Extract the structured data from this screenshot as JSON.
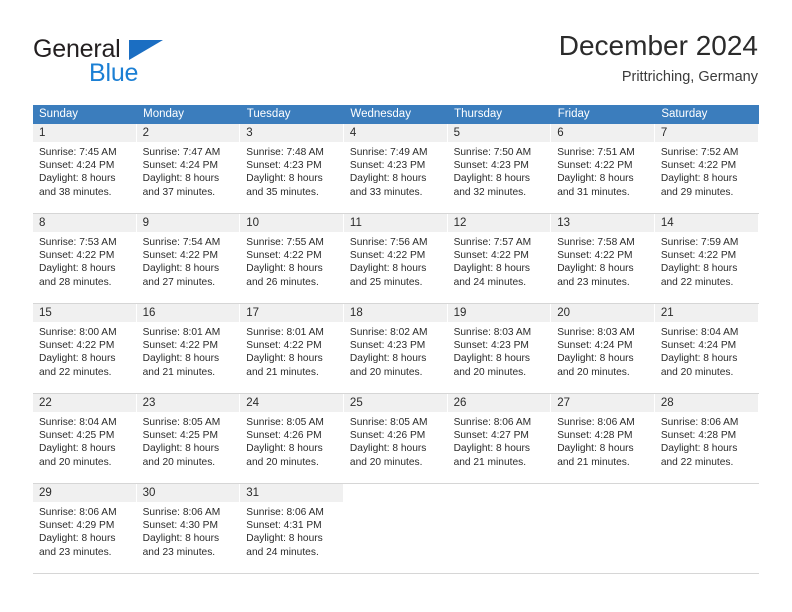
{
  "brand": {
    "name_part1": "General",
    "name_part2": "Blue",
    "triangle_color": "#1b6ec2",
    "blue_color": "#1b7fd4"
  },
  "header": {
    "title": "December 2024",
    "subtitle": "Prittriching, Germany"
  },
  "theme": {
    "header_row_color": "#3b7dbd",
    "daynum_band_color": "#f0f0f0",
    "cell_border_color": "#d6d6d6",
    "text_color": "#2b2b2b"
  },
  "weekday_headers": [
    "Sunday",
    "Monday",
    "Tuesday",
    "Wednesday",
    "Thursday",
    "Friday",
    "Saturday"
  ],
  "weeks": [
    [
      {
        "day": "1",
        "sunrise": "Sunrise: 7:45 AM",
        "sunset": "Sunset: 4:24 PM",
        "daylight_line1": "Daylight: 8 hours",
        "daylight_line2": "and 38 minutes."
      },
      {
        "day": "2",
        "sunrise": "Sunrise: 7:47 AM",
        "sunset": "Sunset: 4:24 PM",
        "daylight_line1": "Daylight: 8 hours",
        "daylight_line2": "and 37 minutes."
      },
      {
        "day": "3",
        "sunrise": "Sunrise: 7:48 AM",
        "sunset": "Sunset: 4:23 PM",
        "daylight_line1": "Daylight: 8 hours",
        "daylight_line2": "and 35 minutes."
      },
      {
        "day": "4",
        "sunrise": "Sunrise: 7:49 AM",
        "sunset": "Sunset: 4:23 PM",
        "daylight_line1": "Daylight: 8 hours",
        "daylight_line2": "and 33 minutes."
      },
      {
        "day": "5",
        "sunrise": "Sunrise: 7:50 AM",
        "sunset": "Sunset: 4:23 PM",
        "daylight_line1": "Daylight: 8 hours",
        "daylight_line2": "and 32 minutes."
      },
      {
        "day": "6",
        "sunrise": "Sunrise: 7:51 AM",
        "sunset": "Sunset: 4:22 PM",
        "daylight_line1": "Daylight: 8 hours",
        "daylight_line2": "and 31 minutes."
      },
      {
        "day": "7",
        "sunrise": "Sunrise: 7:52 AM",
        "sunset": "Sunset: 4:22 PM",
        "daylight_line1": "Daylight: 8 hours",
        "daylight_line2": "and 29 minutes."
      }
    ],
    [
      {
        "day": "8",
        "sunrise": "Sunrise: 7:53 AM",
        "sunset": "Sunset: 4:22 PM",
        "daylight_line1": "Daylight: 8 hours",
        "daylight_line2": "and 28 minutes."
      },
      {
        "day": "9",
        "sunrise": "Sunrise: 7:54 AM",
        "sunset": "Sunset: 4:22 PM",
        "daylight_line1": "Daylight: 8 hours",
        "daylight_line2": "and 27 minutes."
      },
      {
        "day": "10",
        "sunrise": "Sunrise: 7:55 AM",
        "sunset": "Sunset: 4:22 PM",
        "daylight_line1": "Daylight: 8 hours",
        "daylight_line2": "and 26 minutes."
      },
      {
        "day": "11",
        "sunrise": "Sunrise: 7:56 AM",
        "sunset": "Sunset: 4:22 PM",
        "daylight_line1": "Daylight: 8 hours",
        "daylight_line2": "and 25 minutes."
      },
      {
        "day": "12",
        "sunrise": "Sunrise: 7:57 AM",
        "sunset": "Sunset: 4:22 PM",
        "daylight_line1": "Daylight: 8 hours",
        "daylight_line2": "and 24 minutes."
      },
      {
        "day": "13",
        "sunrise": "Sunrise: 7:58 AM",
        "sunset": "Sunset: 4:22 PM",
        "daylight_line1": "Daylight: 8 hours",
        "daylight_line2": "and 23 minutes."
      },
      {
        "day": "14",
        "sunrise": "Sunrise: 7:59 AM",
        "sunset": "Sunset: 4:22 PM",
        "daylight_line1": "Daylight: 8 hours",
        "daylight_line2": "and 22 minutes."
      }
    ],
    [
      {
        "day": "15",
        "sunrise": "Sunrise: 8:00 AM",
        "sunset": "Sunset: 4:22 PM",
        "daylight_line1": "Daylight: 8 hours",
        "daylight_line2": "and 22 minutes."
      },
      {
        "day": "16",
        "sunrise": "Sunrise: 8:01 AM",
        "sunset": "Sunset: 4:22 PM",
        "daylight_line1": "Daylight: 8 hours",
        "daylight_line2": "and 21 minutes."
      },
      {
        "day": "17",
        "sunrise": "Sunrise: 8:01 AM",
        "sunset": "Sunset: 4:22 PM",
        "daylight_line1": "Daylight: 8 hours",
        "daylight_line2": "and 21 minutes."
      },
      {
        "day": "18",
        "sunrise": "Sunrise: 8:02 AM",
        "sunset": "Sunset: 4:23 PM",
        "daylight_line1": "Daylight: 8 hours",
        "daylight_line2": "and 20 minutes."
      },
      {
        "day": "19",
        "sunrise": "Sunrise: 8:03 AM",
        "sunset": "Sunset: 4:23 PM",
        "daylight_line1": "Daylight: 8 hours",
        "daylight_line2": "and 20 minutes."
      },
      {
        "day": "20",
        "sunrise": "Sunrise: 8:03 AM",
        "sunset": "Sunset: 4:24 PM",
        "daylight_line1": "Daylight: 8 hours",
        "daylight_line2": "and 20 minutes."
      },
      {
        "day": "21",
        "sunrise": "Sunrise: 8:04 AM",
        "sunset": "Sunset: 4:24 PM",
        "daylight_line1": "Daylight: 8 hours",
        "daylight_line2": "and 20 minutes."
      }
    ],
    [
      {
        "day": "22",
        "sunrise": "Sunrise: 8:04 AM",
        "sunset": "Sunset: 4:25 PM",
        "daylight_line1": "Daylight: 8 hours",
        "daylight_line2": "and 20 minutes."
      },
      {
        "day": "23",
        "sunrise": "Sunrise: 8:05 AM",
        "sunset": "Sunset: 4:25 PM",
        "daylight_line1": "Daylight: 8 hours",
        "daylight_line2": "and 20 minutes."
      },
      {
        "day": "24",
        "sunrise": "Sunrise: 8:05 AM",
        "sunset": "Sunset: 4:26 PM",
        "daylight_line1": "Daylight: 8 hours",
        "daylight_line2": "and 20 minutes."
      },
      {
        "day": "25",
        "sunrise": "Sunrise: 8:05 AM",
        "sunset": "Sunset: 4:26 PM",
        "daylight_line1": "Daylight: 8 hours",
        "daylight_line2": "and 20 minutes."
      },
      {
        "day": "26",
        "sunrise": "Sunrise: 8:06 AM",
        "sunset": "Sunset: 4:27 PM",
        "daylight_line1": "Daylight: 8 hours",
        "daylight_line2": "and 21 minutes."
      },
      {
        "day": "27",
        "sunrise": "Sunrise: 8:06 AM",
        "sunset": "Sunset: 4:28 PM",
        "daylight_line1": "Daylight: 8 hours",
        "daylight_line2": "and 21 minutes."
      },
      {
        "day": "28",
        "sunrise": "Sunrise: 8:06 AM",
        "sunset": "Sunset: 4:28 PM",
        "daylight_line1": "Daylight: 8 hours",
        "daylight_line2": "and 22 minutes."
      }
    ],
    [
      {
        "day": "29",
        "sunrise": "Sunrise: 8:06 AM",
        "sunset": "Sunset: 4:29 PM",
        "daylight_line1": "Daylight: 8 hours",
        "daylight_line2": "and 23 minutes."
      },
      {
        "day": "30",
        "sunrise": "Sunrise: 8:06 AM",
        "sunset": "Sunset: 4:30 PM",
        "daylight_line1": "Daylight: 8 hours",
        "daylight_line2": "and 23 minutes."
      },
      {
        "day": "31",
        "sunrise": "Sunrise: 8:06 AM",
        "sunset": "Sunset: 4:31 PM",
        "daylight_line1": "Daylight: 8 hours",
        "daylight_line2": "and 24 minutes."
      },
      {
        "day": "",
        "sunrise": "",
        "sunset": "",
        "daylight_line1": "",
        "daylight_line2": ""
      },
      {
        "day": "",
        "sunrise": "",
        "sunset": "",
        "daylight_line1": "",
        "daylight_line2": ""
      },
      {
        "day": "",
        "sunrise": "",
        "sunset": "",
        "daylight_line1": "",
        "daylight_line2": ""
      },
      {
        "day": "",
        "sunrise": "",
        "sunset": "",
        "daylight_line1": "",
        "daylight_line2": ""
      }
    ]
  ]
}
